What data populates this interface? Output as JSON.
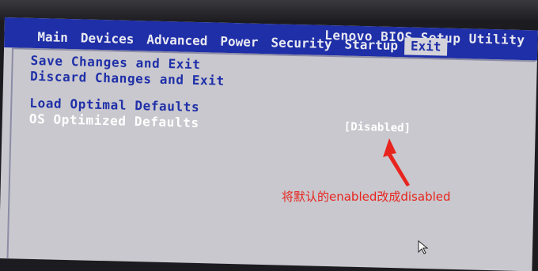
{
  "bios": {
    "utility_title": "Lenovo BIOS Setup Utility",
    "menu_tabs": [
      {
        "label": "Main"
      },
      {
        "label": "Devices"
      },
      {
        "label": "Advanced"
      },
      {
        "label": "Power"
      },
      {
        "label": "Security"
      },
      {
        "label": "Startup"
      },
      {
        "label": "Exit"
      }
    ],
    "active_tab": "Exit",
    "items": [
      {
        "label": "Save Changes and Exit"
      },
      {
        "label": "Discard Changes and Exit"
      },
      {
        "label": "Load Optimal Defaults"
      },
      {
        "label": "OS Optimized Defaults",
        "value": "[Disabled]"
      }
    ]
  },
  "annotation": {
    "text": "将默认的enabled改成disabled",
    "color": "#e8241e"
  },
  "colors": {
    "header_blue": "#1f2fa8",
    "panel_gray": "#c9c8ce",
    "highlight_text": "#ffffff"
  }
}
